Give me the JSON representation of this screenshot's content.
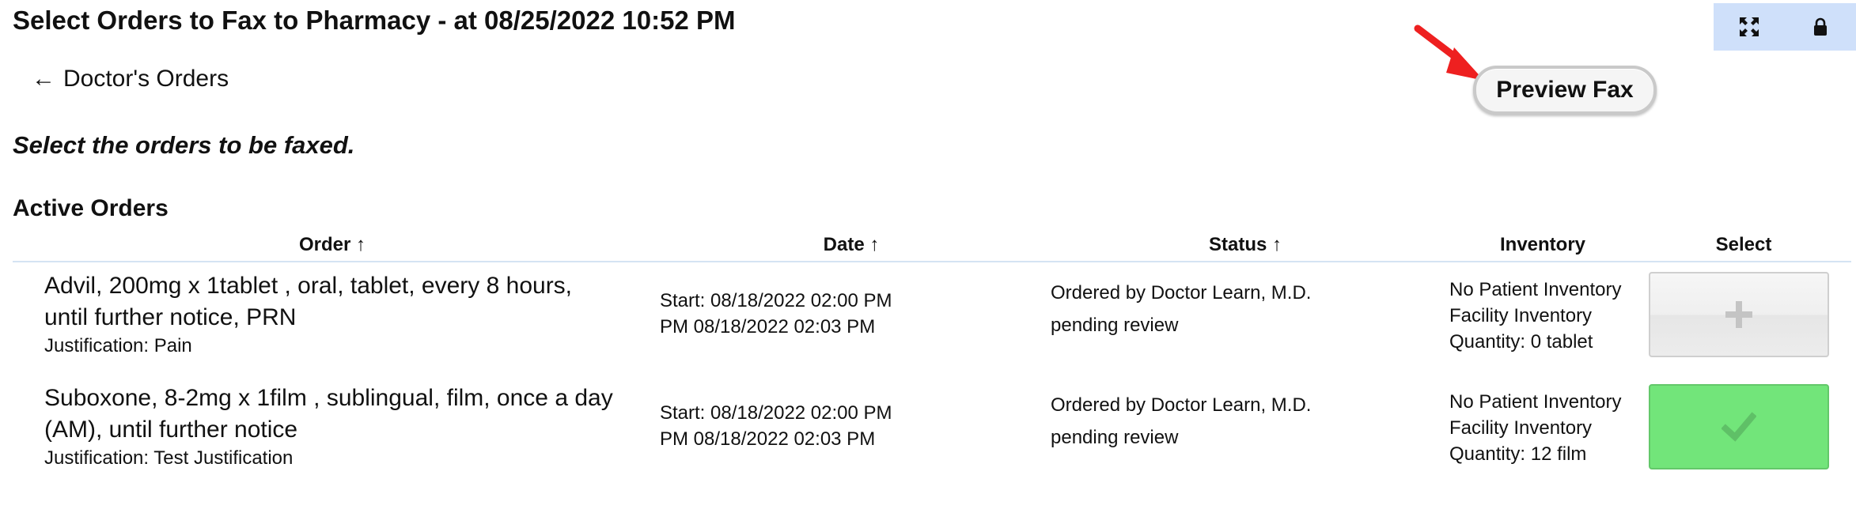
{
  "page": {
    "title": "Select Orders to Fax to Pharmacy - at 08/25/2022 10:52 PM",
    "back_arrow": "←",
    "back_label": "Doctor's Orders",
    "preview_button": "Preview Fax",
    "instruction": "Select the orders to be faxed.",
    "section_title": "Active Orders"
  },
  "top_controls": {
    "expand_icon": "expand-icon",
    "lock_icon": "lock-icon",
    "background": "#cfe0fa"
  },
  "annotation": {
    "color": "#ee2020"
  },
  "table": {
    "columns": [
      "Order ↑",
      "Date ↑",
      "Status ↑",
      "Inventory",
      "Select"
    ],
    "rows": [
      {
        "order_line1": "Advil, 200mg x 1tablet , oral, tablet, every 8 hours,",
        "order_line2": "until further notice, PRN",
        "justification": "Justification: Pain",
        "date_line1": "Start: 08/18/2022 02:00 PM",
        "date_line2": "PM 08/18/2022 02:03 PM",
        "status_line1": "Ordered by Doctor Learn, M.D.",
        "status_line2": "pending review",
        "inv_line1": "No Patient Inventory",
        "inv_line2": "Facility Inventory",
        "inv_line3": "Quantity: 0 tablet",
        "selected": false,
        "select_icon": "plus-icon"
      },
      {
        "order_line1": "Suboxone, 8-2mg x 1film , sublingual, film, once a day",
        "order_line2": "(AM), until further notice",
        "justification": "Justification: Test Justification",
        "date_line1": "Start: 08/18/2022 02:00 PM",
        "date_line2": "PM 08/18/2022 02:03 PM",
        "status_line1": "Ordered by Doctor Learn, M.D.",
        "status_line2": "pending review",
        "inv_line1": "No Patient Inventory",
        "inv_line2": "Facility Inventory",
        "inv_line3": "Quantity: 12 film",
        "selected": true,
        "select_icon": "check-icon"
      }
    ]
  },
  "colors": {
    "selected_green": "#72e57a",
    "header_border": "#d5e3f3"
  }
}
